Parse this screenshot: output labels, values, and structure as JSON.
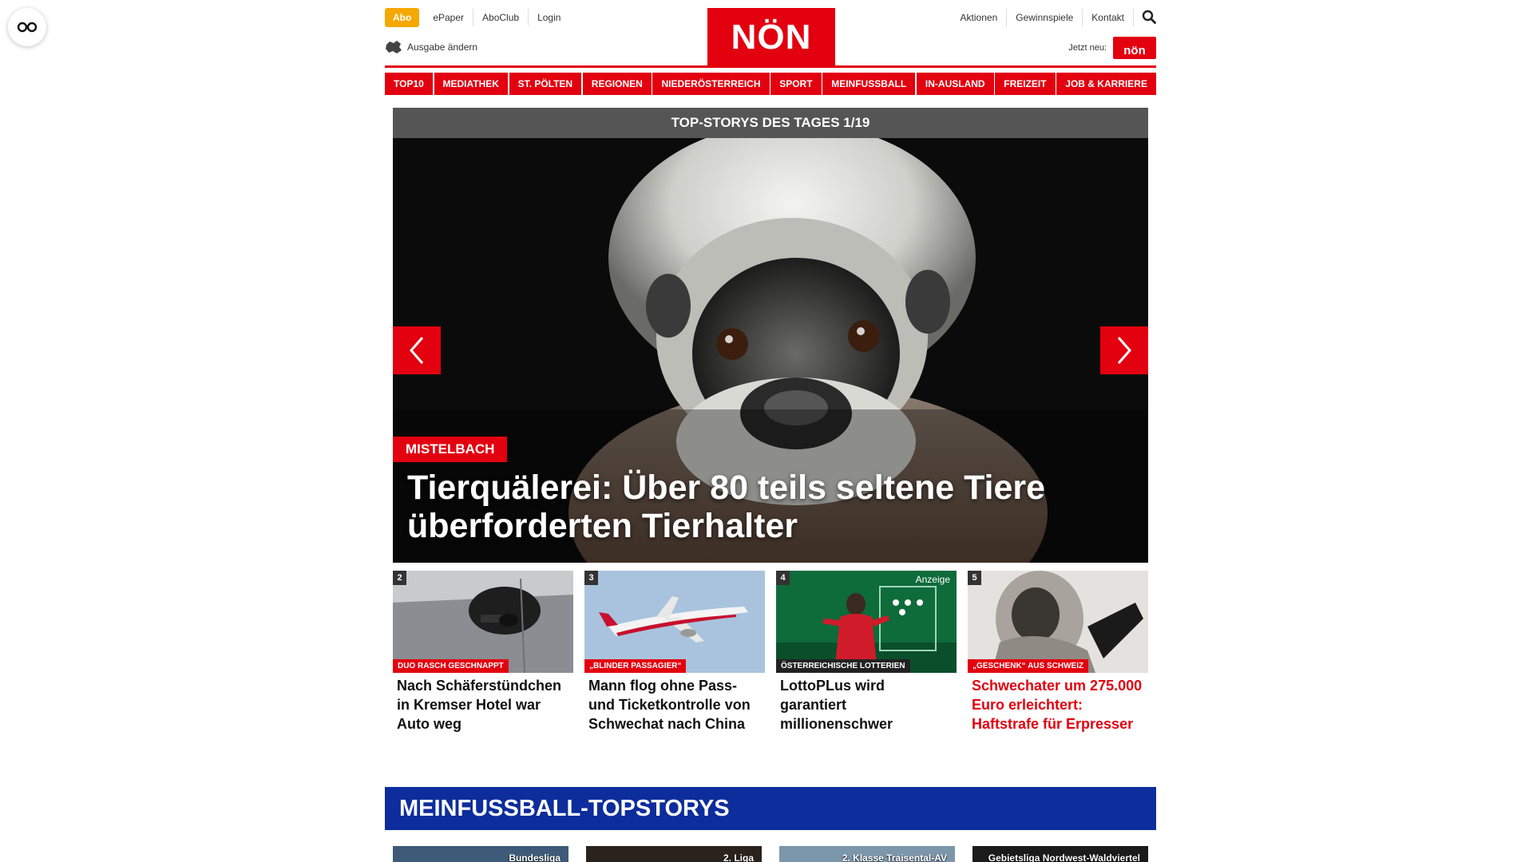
{
  "header": {
    "abo_label": "Abo",
    "top_links_left": [
      "ePaper",
      "AboClub",
      "Login"
    ],
    "edition_label": "Ausgabe ändern",
    "logo_text": "NÖN",
    "top_links_right": [
      "Aktionen",
      "Gewinnspiele",
      "Kontakt"
    ],
    "jetzt_label": "Jetzt neu:",
    "mini_logo_text": "nön"
  },
  "nav": {
    "items": [
      "TOP10",
      "MEDIATHEK",
      "ST. PÖLTEN",
      "REGIONEN",
      "NIEDERÖSTERREICH",
      "SPORT",
      "MEINFUSSBALL",
      "IN-AUSLAND",
      "FREIZEIT",
      "JOB & KARRIERE"
    ]
  },
  "hero": {
    "header": "TOP-STORYS DES TAGES 1/19",
    "tag": "MISTELBACH",
    "title": "Tierquälerei: Über 80 teils seltene Tiere überforderten Tierhalter"
  },
  "cards": [
    {
      "num": "2",
      "tag": "Duo rasch geschnappt",
      "title": "Nach Schäferstündchen in Kremser Hotel war Auto weg",
      "ad": ""
    },
    {
      "num": "3",
      "tag": "„Blinder Passagier“",
      "title": "Mann flog ohne Pass- und Ticketkontrolle von Schwechat nach China",
      "ad": ""
    },
    {
      "num": "4",
      "tag": "Österreichische Lotterien",
      "title": "LottoPLus wird garantiert millionenschwer",
      "ad": "Anzeige"
    },
    {
      "num": "5",
      "tag": "„Geschenk“ aus Schweiz",
      "title": "Schwechater um 275.000 Euro erleichtert: Haftstrafe für Erpresser",
      "ad": ""
    }
  ],
  "football": {
    "title": "MEINFUSSBALL-TOPSTORYS",
    "cards": [
      "Bundesliga",
      "2. Liga",
      "2. Klasse Traisental-AV",
      "Gebietsliga Nordwest-Waldviertel"
    ]
  },
  "colors": {
    "brand_red": "#e3000f",
    "abo_orange": "#f5a800",
    "football_blue": "#0d2d9c"
  }
}
